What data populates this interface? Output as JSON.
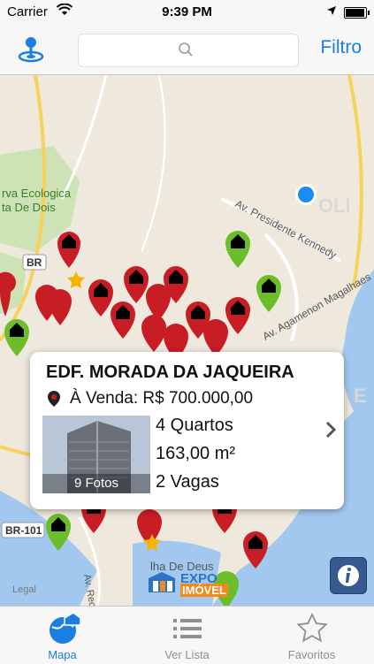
{
  "status_bar": {
    "carrier": "Carrier",
    "time": "9:39 PM"
  },
  "nav": {
    "filter_label": "Filtro"
  },
  "map": {
    "labels": {
      "reserve": "rva Ecologica",
      "reserve2": "ta De Dois",
      "br_top": "BR",
      "avenue": "Av. Presidente Kennedy",
      "avenue2": "Av. Agamenon Magalhaes",
      "br101": "BR-101",
      "island": "lha De Deus",
      "av_rec": "Av. Reci",
      "legal": "Legal",
      "olinda": "OLI",
      "e_letter": "E"
    },
    "logo": {
      "line1": "EXPO",
      "line2": "IMÓVEL"
    }
  },
  "callout": {
    "title": "EDF. MORADA DA JAQUEIRA",
    "price": "À Venda: R$ 700.000,00",
    "photo_count": "9 Fotos",
    "bedrooms": "4 Quartos",
    "area": "163,00 m²",
    "parking": "2 Vagas"
  },
  "tabs": [
    {
      "label": "Mapa",
      "active": true
    },
    {
      "label": "Ver Lista",
      "active": false
    },
    {
      "label": "Favoritos",
      "active": false
    }
  ],
  "colors": {
    "accent": "#1a7fe0",
    "pin_red": "#c81d25",
    "pin_green": "#6cbd2a"
  }
}
